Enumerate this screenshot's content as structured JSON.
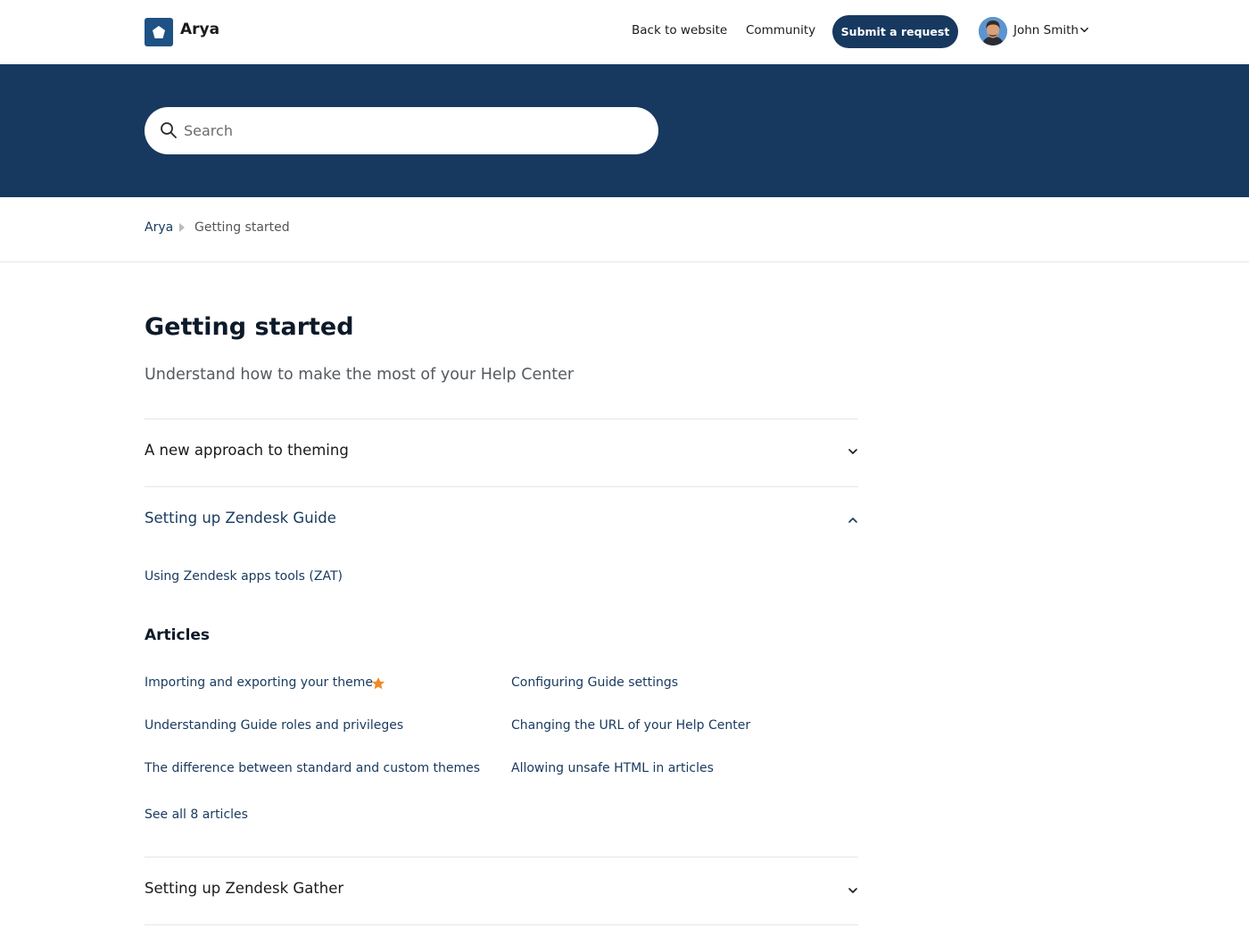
{
  "header": {
    "brand": "Arya",
    "nav": {
      "back": "Back to website",
      "community": "Community"
    },
    "submit_label": "Submit a request",
    "user_name": "John Smith"
  },
  "search": {
    "placeholder": "Search"
  },
  "breadcrumb": {
    "home": "Arya",
    "current": "Getting started"
  },
  "page": {
    "title": "Getting started",
    "description": "Understand how to make the most of your Help Center"
  },
  "sections": [
    {
      "title": "A new approach to theming",
      "expanded": false
    },
    {
      "title": "Setting up Zendesk Guide",
      "expanded": true,
      "subsection": "Using Zendesk apps tools (ZAT)",
      "articles_heading": "Articles",
      "articles": [
        {
          "title": "Importing and exporting your theme",
          "promoted": true
        },
        {
          "title": "Configuring Guide settings"
        },
        {
          "title": "Understanding Guide roles and privileges"
        },
        {
          "title": "Changing the URL of your Help Center"
        },
        {
          "title": "The difference between standard and custom themes"
        },
        {
          "title": "Allowing unsafe HTML in articles"
        }
      ],
      "see_all": "See all 8 articles"
    },
    {
      "title": "Setting up Zendesk Gather",
      "expanded": false
    }
  ],
  "colors": {
    "brand": "#17395f",
    "accent_star": "#f08a24"
  }
}
